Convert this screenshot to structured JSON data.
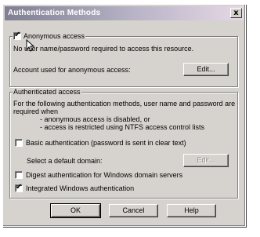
{
  "window": {
    "title": "Authentication Methods",
    "close_symbol": "x"
  },
  "anonymous": {
    "label": "Anonymous access",
    "checked": true,
    "description": "No user name/password required to access this resource.",
    "account_label": "Account used for anonymous access:",
    "edit_label": "Edit..."
  },
  "authenticated": {
    "legend": "Authenticated access",
    "description_lines": [
      "For the following authentication methods, user name and password are",
      "required when",
      "- anonymous access is disabled, or",
      "- access is restricted using NTFS access control lists"
    ],
    "basic_label": "Basic authentication (password is sent in clear text)",
    "basic_checked": false,
    "domain_label": "Select a default domain:",
    "domain_edit_label": "Edit...",
    "digest_label": "Digest authentication for Windows domain servers",
    "digest_checked": false,
    "integrated_label": "Integrated Windows authentication",
    "integrated_checked": true
  },
  "buttons": {
    "ok": "OK",
    "cancel": "Cancel",
    "help": "Help"
  },
  "icons": {
    "close": "close-icon",
    "checkmark": "checkmark-icon",
    "cursor": "mouse-pointer-icon"
  }
}
